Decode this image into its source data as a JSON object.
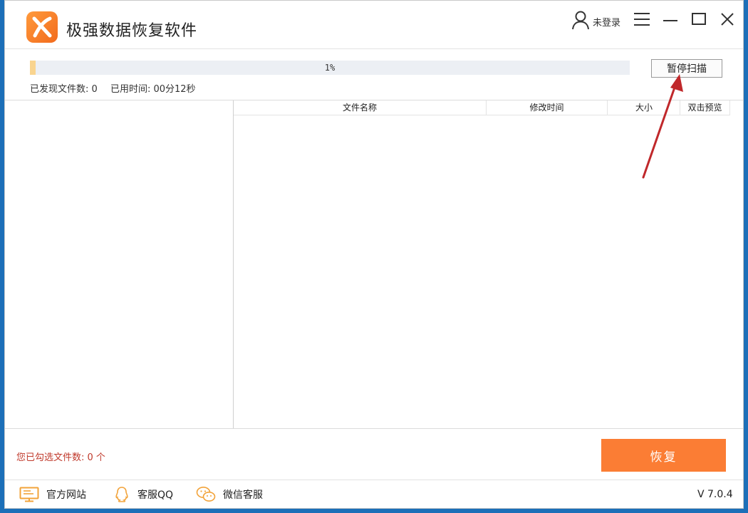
{
  "app": {
    "title": "极强数据恢复软件"
  },
  "user": {
    "label": "未登录"
  },
  "scan": {
    "progress_percent": 1,
    "progress_text": "1%",
    "pause_label": "暂停扫描",
    "found_files": "已发现文件数: 0",
    "elapsed": "已用时间: 00分12秒"
  },
  "table": {
    "columns": [
      "文件名称",
      "修改时间",
      "大小",
      "双击预览"
    ]
  },
  "selection": {
    "summary": "您已勾选文件数: 0 个"
  },
  "actions": {
    "recover_label": "恢复"
  },
  "footer": {
    "links": [
      "官方网站",
      "客服QQ",
      "微信客服"
    ],
    "version": "V 7.0.4"
  },
  "colors": {
    "accent": "#fb7d34",
    "progress": "#f9d48f",
    "warning_text": "#c0392b",
    "annotation_arrow": "#c0282b"
  },
  "icons": [
    "app-logo-icon",
    "user-icon",
    "menu-icon",
    "minimize-icon",
    "maximize-icon",
    "close-icon",
    "monitor-icon",
    "qq-icon",
    "wechat-icon"
  ]
}
